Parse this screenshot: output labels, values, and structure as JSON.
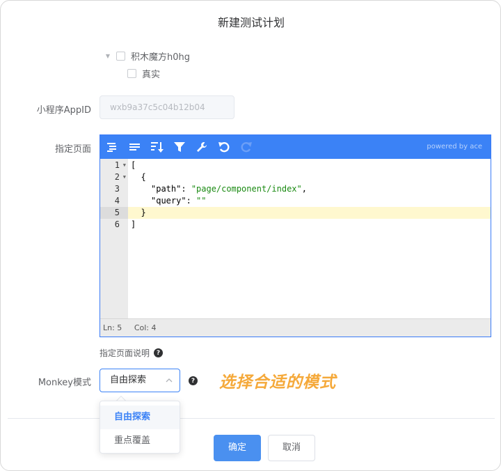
{
  "dialog": {
    "title": "新建测试计划"
  },
  "tree": {
    "parent_label": "积木魔方h0hg",
    "child_label": "真实"
  },
  "form": {
    "appid_label": "小程序AppID",
    "appid_placeholder": "wxb9a37c5c04b12b04",
    "pages_label": "指定页面",
    "pages_help": "指定页面说明",
    "monkey_label": "Monkey模式",
    "monkey_value": "自由探索"
  },
  "editor": {
    "powered_by": "powered by ace",
    "line_numbers": [
      "1",
      "2",
      "3",
      "4",
      "5",
      "6"
    ],
    "lines": {
      "l1": "[",
      "l2": "  {",
      "l3_key": "\"path\"",
      "l3_colon": ": ",
      "l3_val": "\"page/component/index\"",
      "l3_comma": ",",
      "l4_key": "\"query\"",
      "l4_colon": ": ",
      "l4_val": "\"\"",
      "l5": "  }",
      "l6": "]"
    },
    "status_line": "Ln: 5",
    "status_col": "Col: 4",
    "toolbar_icons": [
      "format-icon",
      "compact-icon",
      "sort-icon",
      "filter-icon",
      "wrench-icon",
      "undo-icon",
      "redo-icon"
    ]
  },
  "annotation": "选择合适的模式",
  "dropdown": {
    "options": [
      "自由探索",
      "重点覆盖"
    ],
    "selected_index": 0
  },
  "buttons": {
    "confirm": "确定",
    "cancel": "取消"
  },
  "colors": {
    "accent": "#3b82f6",
    "annotation": "#f5a93a",
    "editor_active_line": "#fff8cf"
  }
}
